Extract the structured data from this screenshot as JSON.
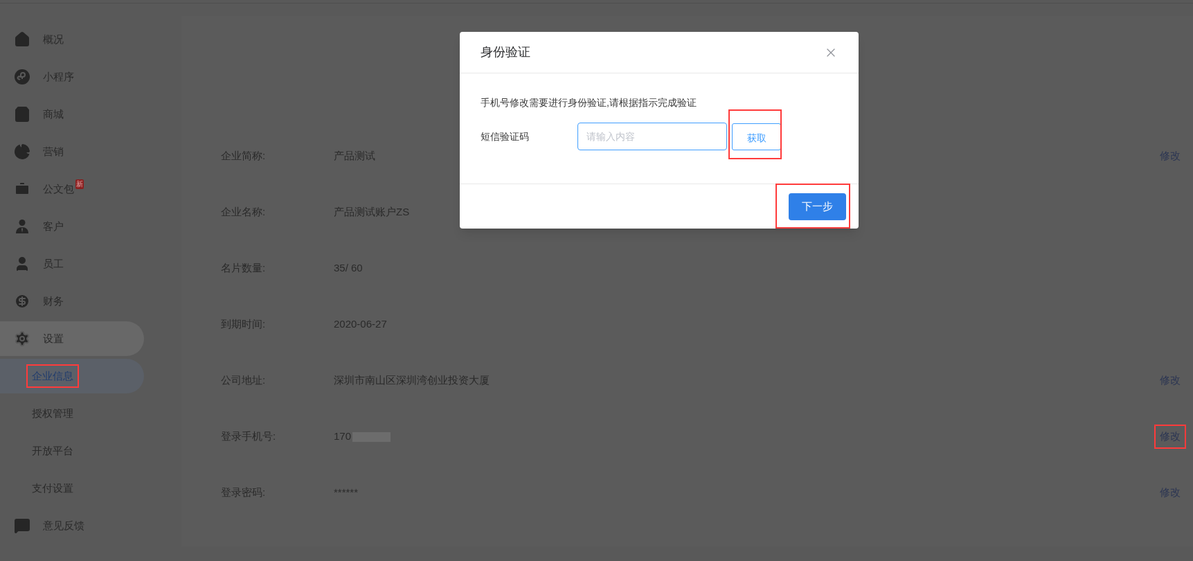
{
  "sidebar": {
    "items": [
      {
        "label": "概况"
      },
      {
        "label": "小程序"
      },
      {
        "label": "商城"
      },
      {
        "label": "营销"
      },
      {
        "label": "公文包",
        "badge": "新"
      },
      {
        "label": "客户"
      },
      {
        "label": "员工"
      },
      {
        "label": "财务"
      },
      {
        "label": "设置",
        "expanded": true,
        "children": [
          {
            "label": "企业信息",
            "selected": true,
            "highlighted": true
          },
          {
            "label": "授权管理",
            "selected": false,
            "highlighted": false
          },
          {
            "label": "开放平台",
            "selected": false,
            "highlighted": false
          },
          {
            "label": "支付设置",
            "selected": false,
            "highlighted": false
          }
        ]
      },
      {
        "label": "意见反馈"
      }
    ]
  },
  "info_rows": [
    {
      "label": "企业简称:",
      "value": "产品测试",
      "action": "修改",
      "action_highlighted": false
    },
    {
      "label": "企业名称:",
      "value": "产品测试账户ZS"
    },
    {
      "label": "名片数量:",
      "value": "35/ 60"
    },
    {
      "label": "到期时间:",
      "value": "2020-06-27"
    },
    {
      "label": "公司地址:",
      "value": "深圳市南山区深圳湾创业投资大厦",
      "action": "修改",
      "action_highlighted": false
    },
    {
      "label": "登录手机号:",
      "value": "170",
      "masked": true,
      "action": "修改",
      "action_highlighted": true
    },
    {
      "label": "登录密码:",
      "value": "******",
      "action": "修改",
      "action_highlighted": false
    }
  ],
  "dialog": {
    "title": "身份验证",
    "message": "手机号修改需要进行身份验证,请根据指示完成验证",
    "field_label": "短信验证码",
    "placeholder": "请输入内容",
    "get_code_button": {
      "label": "获取",
      "highlighted": true
    },
    "next_button": {
      "label": "下一步",
      "highlighted": true
    }
  }
}
